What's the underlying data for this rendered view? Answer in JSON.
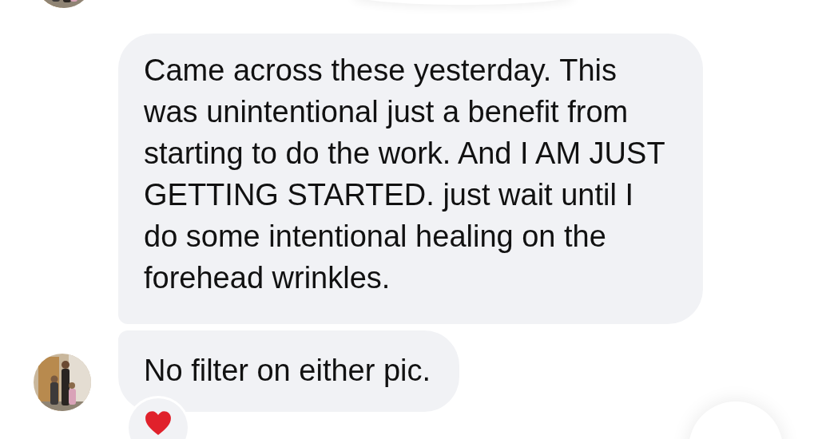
{
  "messages": [
    {
      "text": "Came across these yesterday. This was unintentional just a benefit from starting to do the work. And I AM JUST GETTING STARTED. just wait until I do some intentional healing on the forehead wrinkles.",
      "avatar": false
    },
    {
      "text": "No filter on either pic.",
      "avatar": true
    }
  ]
}
